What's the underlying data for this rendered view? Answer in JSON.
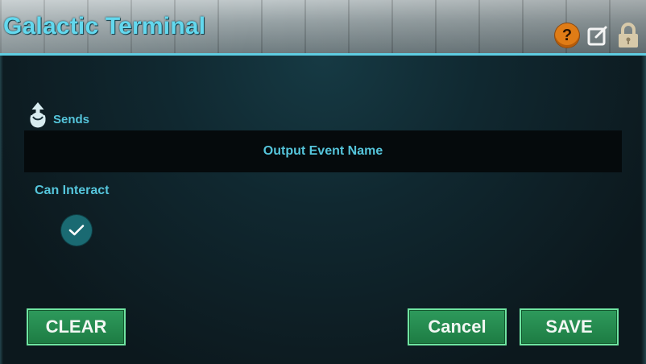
{
  "header": {
    "title": "Galactic Terminal"
  },
  "icons": {
    "help": "help-icon",
    "edit": "edit-icon",
    "lock": "lock-icon"
  },
  "colors": {
    "accent": "#55c5db",
    "title": "#63d8ee",
    "button": "#24854b",
    "button_border": "#6fe4a1",
    "help": "#e07c16"
  },
  "sends": {
    "label": "Sends",
    "icon": "upload-icon"
  },
  "event_field": {
    "placeholder": "Output Event Name"
  },
  "can_interact": {
    "label": "Can Interact",
    "checked": true
  },
  "buttons": {
    "clear": "CLEAR",
    "cancel": "Cancel",
    "save": "SAVE"
  }
}
